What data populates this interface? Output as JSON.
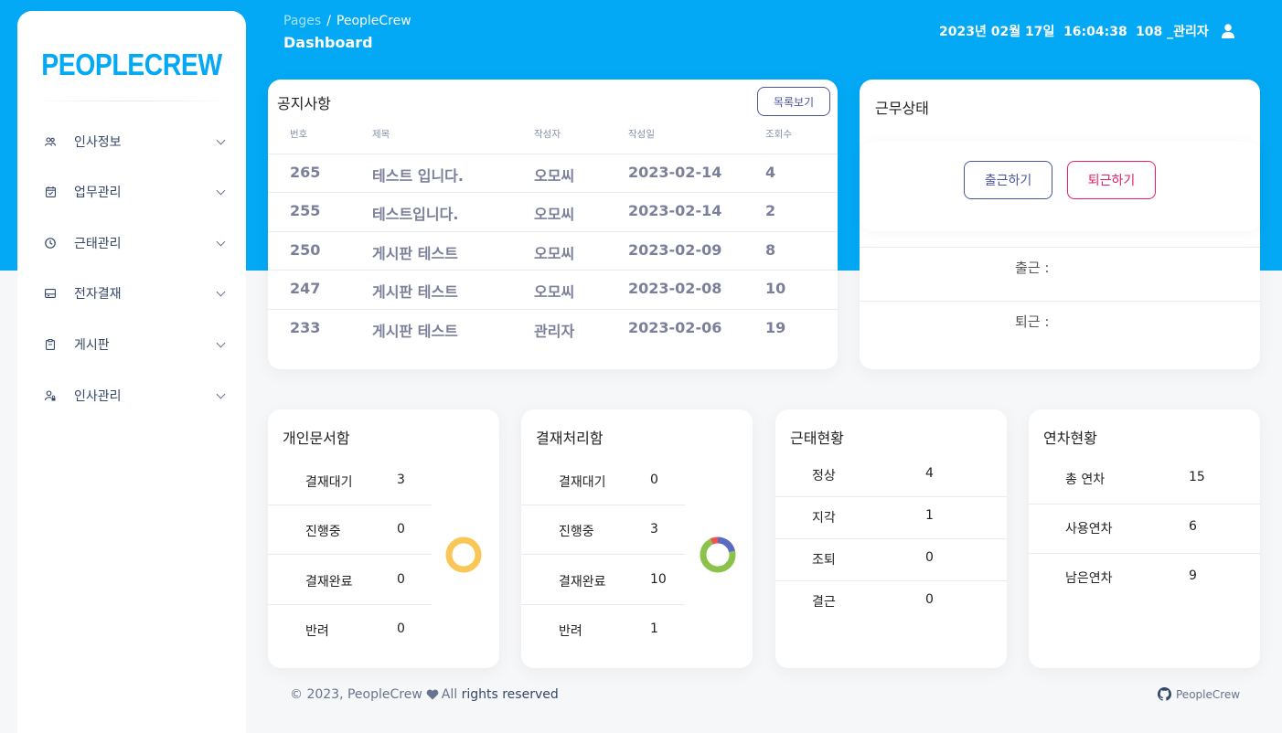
{
  "brand": {
    "logo": "PEOPLECREW",
    "accent": "#03a9f4"
  },
  "sidebar": {
    "items": [
      {
        "label": "인사정보",
        "icon": "people-icon"
      },
      {
        "label": "업무관리",
        "icon": "calendar-check-icon"
      },
      {
        "label": "근태관리",
        "icon": "clock-icon"
      },
      {
        "label": "전자결재",
        "icon": "tray-icon"
      },
      {
        "label": "게시판",
        "icon": "clipboard-icon"
      },
      {
        "label": "인사관리",
        "icon": "user-lock-icon"
      }
    ]
  },
  "header": {
    "breadcrumb_root": "Pages",
    "breadcrumb_sep": "/",
    "breadcrumb_current": "PeopleCrew",
    "title": "Dashboard",
    "datetime": "2023년 02월 17일  16:04:38",
    "user": "108 _관리자"
  },
  "notice": {
    "title": "공지사항",
    "list_button": "목록보기",
    "columns": [
      "번호",
      "제목",
      "작성자",
      "작성일",
      "조회수"
    ],
    "rows": [
      {
        "no": "265",
        "subject": "테스트 입니다.",
        "author": "오모씨",
        "date": "2023-02-14",
        "views": "4"
      },
      {
        "no": "255",
        "subject": "테스트입니다.",
        "author": "오모씨",
        "date": "2023-02-14",
        "views": "2"
      },
      {
        "no": "250",
        "subject": "게시판 테스트",
        "author": "오모씨",
        "date": "2023-02-09",
        "views": "8"
      },
      {
        "no": "247",
        "subject": "게시판 테스트",
        "author": "오모씨",
        "date": "2023-02-08",
        "views": "10"
      },
      {
        "no": "233",
        "subject": "게시판 테스트",
        "author": "관리자",
        "date": "2023-02-06",
        "views": "19"
      }
    ]
  },
  "work_status": {
    "title": "근무상태",
    "check_in_button": "출근하기",
    "check_out_button": "퇴근하기",
    "check_in_label": "출근 :",
    "check_out_label": "퇴근 :"
  },
  "personal_docs": {
    "title": "개인문서함",
    "rows": [
      {
        "label": "결재대기",
        "value": "3"
      },
      {
        "label": "진행중",
        "value": "0"
      },
      {
        "label": "결재완료",
        "value": "0"
      },
      {
        "label": "반려",
        "value": "0"
      }
    ],
    "donut_colors": [
      "#fbc658",
      "#4a8bd6",
      "#8bc34a",
      "#ef5350"
    ]
  },
  "approval_docs": {
    "title": "결재처리함",
    "rows": [
      {
        "label": "결재대기",
        "value": "0"
      },
      {
        "label": "진행중",
        "value": "3"
      },
      {
        "label": "결재완료",
        "value": "10"
      },
      {
        "label": "반려",
        "value": "1"
      }
    ],
    "donut_colors": [
      "#fbc658",
      "#5c6bc0",
      "#8bc34a",
      "#ef5350"
    ]
  },
  "attendance": {
    "title": "근태현황",
    "rows": [
      {
        "label": "정상",
        "value": "4"
      },
      {
        "label": "지각",
        "value": "1"
      },
      {
        "label": "조퇴",
        "value": "0"
      },
      {
        "label": "결근",
        "value": "0"
      }
    ]
  },
  "leave": {
    "title": "연차현황",
    "rows": [
      {
        "label": "총 연차",
        "value": "15"
      },
      {
        "label": "사용연차",
        "value": "6"
      },
      {
        "label": "남은연차",
        "value": "9"
      }
    ]
  },
  "footer": {
    "copyright": "© 2023, PeopleCrew",
    "all": "All",
    "rights": "rights reserved",
    "link": "PeopleCrew"
  }
}
